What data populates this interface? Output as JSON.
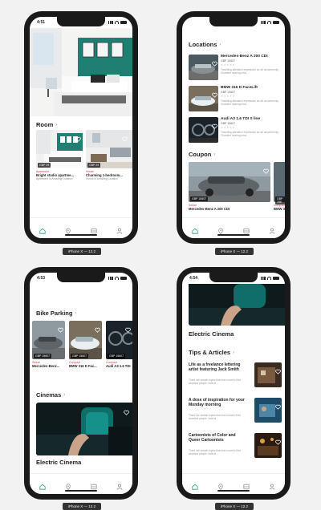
{
  "devices": [
    {
      "caption": "iPhone X — 12.2",
      "time": "4:51",
      "room": {
        "title": "Room",
        "cards": [
          {
            "price": "GBP 29",
            "category": "Apartment",
            "title": "Bright studio apartme...",
            "subtitle": "Apartment in Amazing Location"
          },
          {
            "price": "GBP 29",
            "category": "House",
            "title": "Charming 1-bedroom...",
            "subtitle": "House in Amazing Location"
          }
        ]
      }
    },
    {
      "caption": "iPhone X — 12.2",
      "locations": {
        "title": "Locations",
        "items": [
          {
            "title": "Mercedes-Benz A 200 CDI",
            "price": "GBP 15607",
            "desc": "Travelling alteration impression six all uncommonly. Chamber hearing inha..."
          },
          {
            "title": "BMW 316 D FaceLift",
            "price": "GBP 15607",
            "desc": "Travelling alteration impression six all uncommonly. Chamber hearing inha..."
          },
          {
            "title": "Audi A3 1.6 TDI S line",
            "price": "GBP 15607",
            "desc": "Travelling alteration impression six all uncommonly. Chamber hearing inha..."
          }
        ]
      },
      "coupon": {
        "title": "Coupon",
        "cards": [
          {
            "price": "GBP 15607",
            "category": "Sedan",
            "title": "Mercedes-Benz A 200 CDI"
          },
          {
            "price": "GBP 156",
            "category": "Compact",
            "title": "BMW 31"
          }
        ]
      }
    },
    {
      "caption": "iPhone X — 12.2",
      "time": "4:53",
      "bike": {
        "title": "Bike Parking",
        "cards": [
          {
            "price": "GBP 15607",
            "category": "Sedan",
            "title": "Mercedes-Benz..."
          },
          {
            "price": "GBP 15607",
            "category": "Compact",
            "title": "BMW 316 D Fac..."
          },
          {
            "price": "GBP 15607",
            "category": "Compact",
            "title": "Audi A3 1.6 TDI"
          }
        ]
      },
      "cinemas": {
        "title": "Cinemas",
        "card_title": "Electric Cinema"
      }
    },
    {
      "caption": "iPhone X — 12.2",
      "time": "4:54",
      "cinema_card_title": "Electric Cinema",
      "tips": {
        "title": "Tips & Articles",
        "items": [
          {
            "title": "Life as a freelance lettering artist featuring Jack Smith",
            "desc": "There are certain topics that even some of the smartest people I talk wi..."
          },
          {
            "title": "A dose of inspiration for your Monday morning",
            "desc": "There are certain topics that even some of the smartest people I talk wi..."
          },
          {
            "title": "Cartoonists of Color and Queer Cartoonists",
            "desc": "There are certain topics that even some of the smartest people I talk wi..."
          }
        ]
      }
    }
  ],
  "colors": {
    "accent": "#2a9d8f",
    "category": "#e63946",
    "tabbar_icon": "#9a9a9a"
  },
  "tabbar_icons": [
    "home-icon",
    "location-pin-icon",
    "list-icon",
    "profile-icon"
  ]
}
